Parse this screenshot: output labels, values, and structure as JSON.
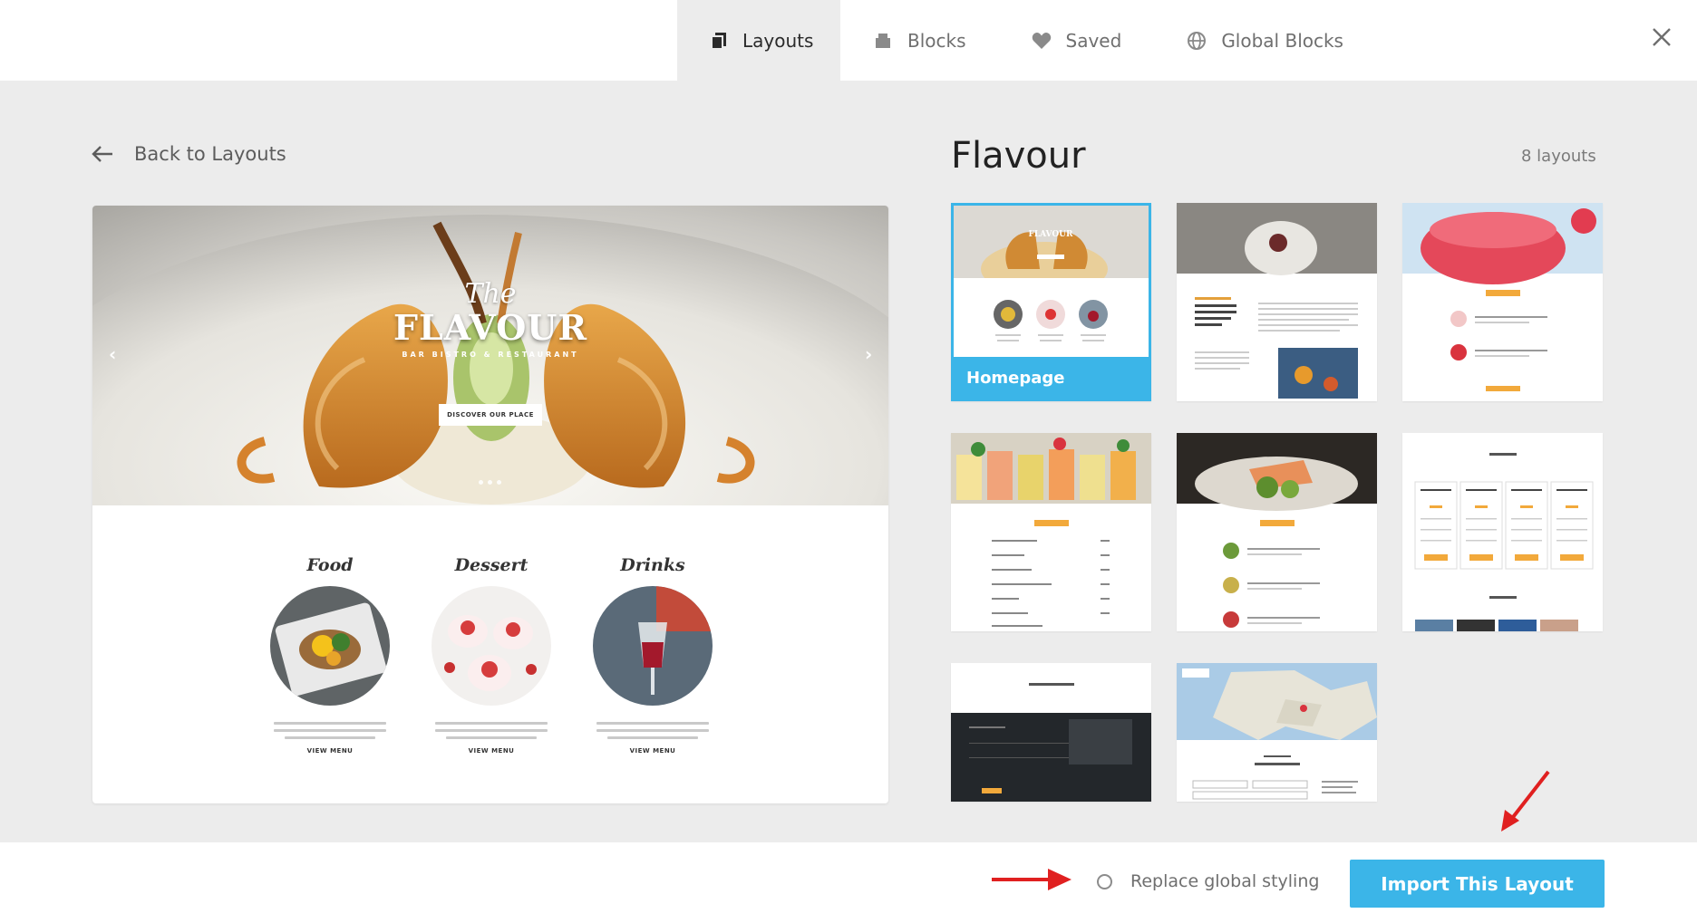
{
  "tabs": [
    {
      "label": "Layouts",
      "icon": "layouts-icon",
      "active": true
    },
    {
      "label": "Blocks",
      "icon": "blocks-icon",
      "active": false
    },
    {
      "label": "Saved",
      "icon": "heart-icon",
      "active": false
    },
    {
      "label": "Global Blocks",
      "icon": "globe-icon",
      "active": false
    }
  ],
  "back_label": "Back to Layouts",
  "preview": {
    "hero_script": "The",
    "hero_title": "FLAVOUR",
    "hero_subtitle": "BAR BISTRO & RESTAURANT",
    "hero_button": "DISCOVER OUR PLACE",
    "categories": [
      {
        "title": "Food",
        "link": "VIEW MENU"
      },
      {
        "title": "Dessert",
        "link": "VIEW MENU"
      },
      {
        "title": "Drinks",
        "link": "VIEW MENU"
      }
    ]
  },
  "pack": {
    "title": "Flavour",
    "count": "8 layouts",
    "selected_label": "Homepage"
  },
  "footer": {
    "replace_label": "Replace global styling",
    "replace_checked": false,
    "import_label": "Import This Layout"
  },
  "colors": {
    "accent": "#3bb5e8",
    "annotation_arrow": "#e02020",
    "background": "#ececec"
  }
}
